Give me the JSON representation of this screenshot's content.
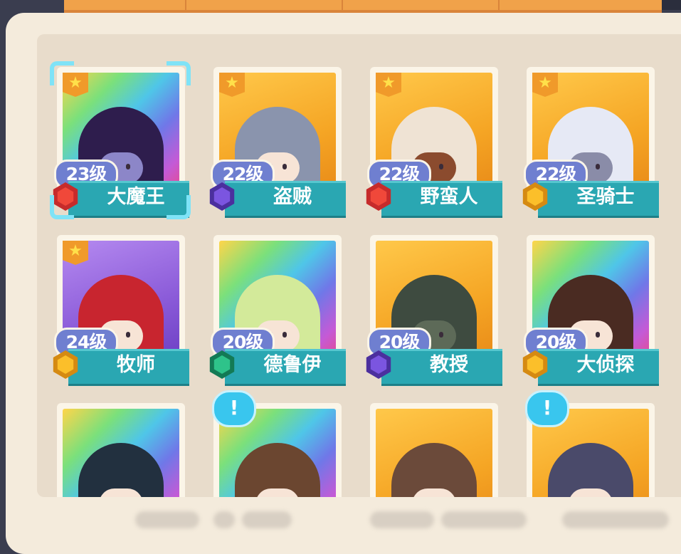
{
  "colors": {
    "name_bar": "#2aa7b2",
    "level_pill": "#6f7fd0",
    "panel_bg": "#f4ebdc",
    "selection": "#7fe3f7",
    "notice": "#39c6ee"
  },
  "heroes": [
    {
      "level": "23级",
      "name": "大魔王",
      "rarity_bg": "rainbow",
      "starred": true,
      "badge": "red",
      "badge_icon": "shield-icon",
      "selected": true,
      "hair": "#2e1d4d",
      "skin": "#8c86c8"
    },
    {
      "level": "22级",
      "name": "盗贼",
      "rarity_bg": "gold",
      "starred": true,
      "badge": "purple",
      "badge_icon": "dagger-icon",
      "selected": false,
      "hair": "#8a94ad",
      "skin": "#f7e4d6"
    },
    {
      "level": "22级",
      "name": "野蛮人",
      "rarity_bg": "gold",
      "starred": true,
      "badge": "red",
      "badge_icon": "shield-icon",
      "selected": false,
      "hair": "#efe3d4",
      "skin": "#8b4b2e"
    },
    {
      "level": "22级",
      "name": "圣骑士",
      "rarity_bg": "gold",
      "starred": true,
      "badge": "gold",
      "badge_icon": "shield-icon",
      "selected": false,
      "hair": "#e6e9f5",
      "skin": "#8a8ca8"
    },
    {
      "level": "24级",
      "name": "牧师",
      "rarity_bg": "purple",
      "starred": true,
      "badge": "gold",
      "badge_icon": "hand-icon",
      "selected": false,
      "hair": "#c8252f",
      "skin": "#f7e4d6"
    },
    {
      "level": "20级",
      "name": "德鲁伊",
      "rarity_bg": "rainbow",
      "starred": false,
      "badge": "green",
      "badge_icon": "hand-icon",
      "selected": false,
      "hair": "#d3ea9a",
      "skin": "#f7e4d6"
    },
    {
      "level": "20级",
      "name": "教授",
      "rarity_bg": "gold",
      "starred": false,
      "badge": "purple",
      "badge_icon": "hand-icon",
      "selected": false,
      "hair": "#3e4b40",
      "skin": "#5d6a58"
    },
    {
      "level": "20级",
      "name": "大侦探",
      "rarity_bg": "rainbow",
      "starred": false,
      "badge": "gold",
      "badge_icon": "hand-icon",
      "selected": false,
      "hair": "#4a2b22",
      "skin": "#f7e4d6"
    },
    {
      "level": "",
      "name": "",
      "rarity_bg": "rainbow",
      "starred": false,
      "badge": "",
      "selected": false,
      "hair": "#22303f",
      "skin": "#f7e4d6",
      "notice": false
    },
    {
      "level": "",
      "name": "",
      "rarity_bg": "rainbow",
      "starred": false,
      "badge": "",
      "selected": false,
      "hair": "#6b4630",
      "skin": "#f7e4d6",
      "notice": true
    },
    {
      "level": "",
      "name": "",
      "rarity_bg": "gold",
      "starred": false,
      "badge": "",
      "selected": false,
      "hair": "#6b4a3a",
      "skin": "#f7e4d6",
      "notice": false
    },
    {
      "level": "",
      "name": "",
      "rarity_bg": "gold",
      "starred": false,
      "badge": "",
      "selected": false,
      "hair": "#4a4a6a",
      "skin": "#f7e4d6",
      "notice": true
    }
  ],
  "notice_symbol": "!"
}
